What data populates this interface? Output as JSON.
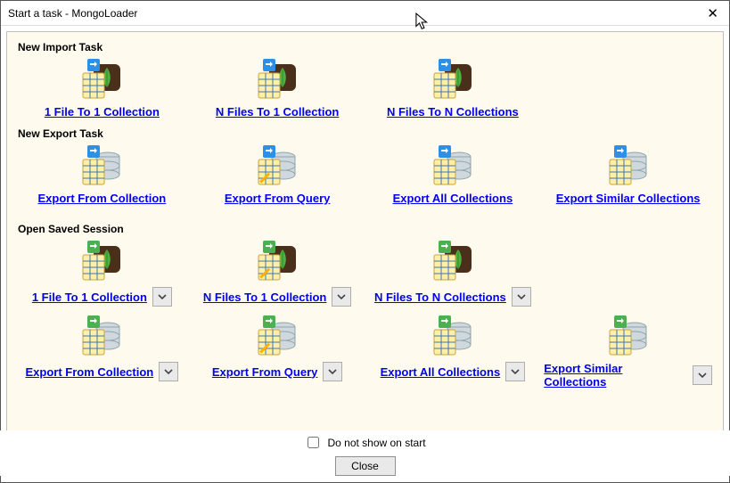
{
  "window_title": "Start a task - MongoLoader",
  "sections": {
    "import": "New Import Task",
    "export": "New Export Task",
    "session": "Open Saved Session"
  },
  "tasks": {
    "import": [
      {
        "label": "1 File To 1 Collection",
        "icon": "import-one"
      },
      {
        "label": "N Files To 1 Collection",
        "icon": "import-one"
      },
      {
        "label": "N Files To N Collections",
        "icon": "import-one"
      }
    ],
    "export": [
      {
        "label": "Export From Collection",
        "icon": "export-db"
      },
      {
        "label": "Export From Query",
        "icon": "export-db-edit"
      },
      {
        "label": "Export All Collections",
        "icon": "export-db"
      },
      {
        "label": "Export Similar Collections",
        "icon": "export-db"
      }
    ],
    "session_import": [
      {
        "label": "1 File To 1 Collection",
        "icon": "session-import"
      },
      {
        "label": "N Files To 1 Collection",
        "icon": "session-import-edit"
      },
      {
        "label": "N Files To N  Collections",
        "icon": "session-import"
      }
    ],
    "session_export": [
      {
        "label": "Export From Collection",
        "icon": "session-export"
      },
      {
        "label": "Export From Query",
        "icon": "session-export-edit"
      },
      {
        "label": "Export All Collections",
        "icon": "session-export"
      },
      {
        "label": "Export Similar Collections",
        "icon": "session-export"
      }
    ]
  },
  "footer": {
    "checkbox_label": "Do not show on start",
    "checkbox_checked": false,
    "close_button": "Close"
  }
}
